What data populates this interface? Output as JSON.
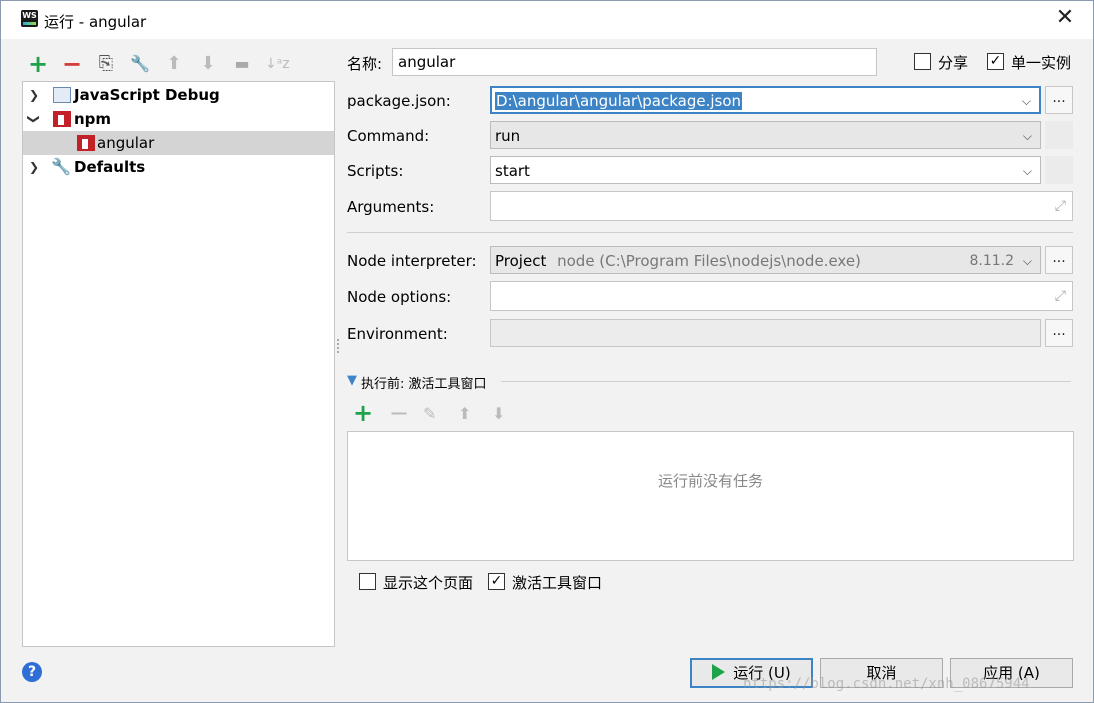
{
  "window": {
    "title": "运行 - angular",
    "close_glyph": "✕",
    "app_icon_text": "WS"
  },
  "toolbar": {
    "add": "+",
    "remove": "−",
    "copy": "⎘",
    "edit_defaults": "🔧",
    "move_up": "⬆",
    "move_down": "⬇",
    "folder": "▬",
    "sort": "↓ᵃz"
  },
  "tree": {
    "items": [
      {
        "label": "JavaScript Debug",
        "expanded": false
      },
      {
        "label": "npm",
        "expanded": true
      },
      {
        "label": "angular",
        "selected": true
      },
      {
        "label": "Defaults",
        "expanded": false
      }
    ]
  },
  "form": {
    "name_label": "名称:",
    "name_value": "angular",
    "share_label": "分享",
    "share_checked": false,
    "single_instance_label": "单一实例",
    "single_instance_checked": true,
    "package_json_label": "package.json:",
    "package_json_value": "D:\\angular\\angular\\package.json",
    "command_label": "Command:",
    "command_value": "run",
    "scripts_label": "Scripts:",
    "scripts_value": "start",
    "arguments_label": "Arguments:",
    "arguments_value": "",
    "node_interpreter_label": "Node interpreter:",
    "node_interpreter_project": "Project",
    "node_interpreter_path": "node (C:\\Program Files\\nodejs\\node.exe)",
    "node_interpreter_version": "8.11.2",
    "node_options_label": "Node options:",
    "node_options_value": "",
    "environment_label": "Environment:",
    "environment_value": "",
    "browse": "..."
  },
  "before_launch": {
    "title": "执行前: 激活工具窗口",
    "empty_message": "运行前没有任务",
    "show_page_label": "显示这个页面",
    "show_page_checked": false,
    "activate_tool_label": "激活工具窗口",
    "activate_tool_checked": true
  },
  "buttons": {
    "run": "运行 (U)",
    "cancel": "取消",
    "apply": "应用 (A)",
    "help": "?"
  },
  "watermark": "https://blog.csdn.net/xnh_08675944",
  "colors": {
    "accent": "#3d84c6",
    "add_green": "#1ea24a",
    "remove_red": "#d43b3b",
    "npm_red": "#c12127"
  }
}
